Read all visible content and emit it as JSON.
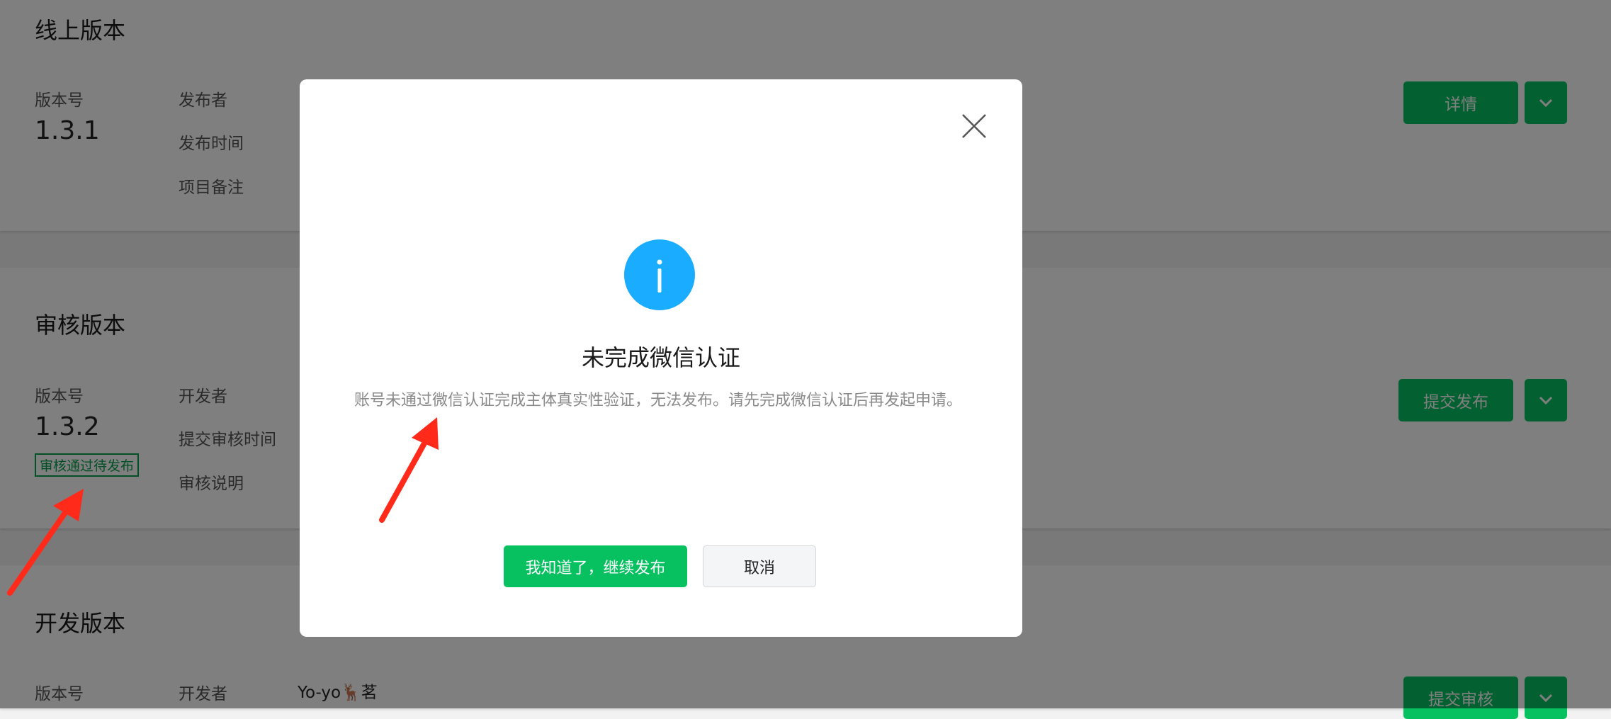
{
  "online": {
    "title": "线上版本",
    "version_label": "版本号",
    "version": "1.3.1",
    "publisher_label": "发布者",
    "publish_time_label": "发布时间",
    "remark_label": "项目备注",
    "details_button": "详情"
  },
  "review": {
    "title": "审核版本",
    "version_label": "版本号",
    "version": "1.3.2",
    "status": "审核通过待发布",
    "developer_label": "开发者",
    "submit_time_label": "提交审核时间",
    "review_note_label": "审核说明",
    "publish_button": "提交发布"
  },
  "dev": {
    "title": "开发版本",
    "version_label": "版本号",
    "developer_label": "开发者",
    "developer": "Yo-yo🦌茗",
    "submit_review_button": "提交审核"
  },
  "dialog": {
    "title": "未完成微信认证",
    "message": "账号未通过微信认证完成主体真实性验证，无法发布。请先完成微信认证后再发起申请。",
    "confirm": "我知道了，继续发布",
    "cancel": "取消"
  },
  "colors": {
    "primary_green": "#07c160",
    "info_blue": "#1aadff",
    "annotation_red": "#ff2a1a"
  }
}
